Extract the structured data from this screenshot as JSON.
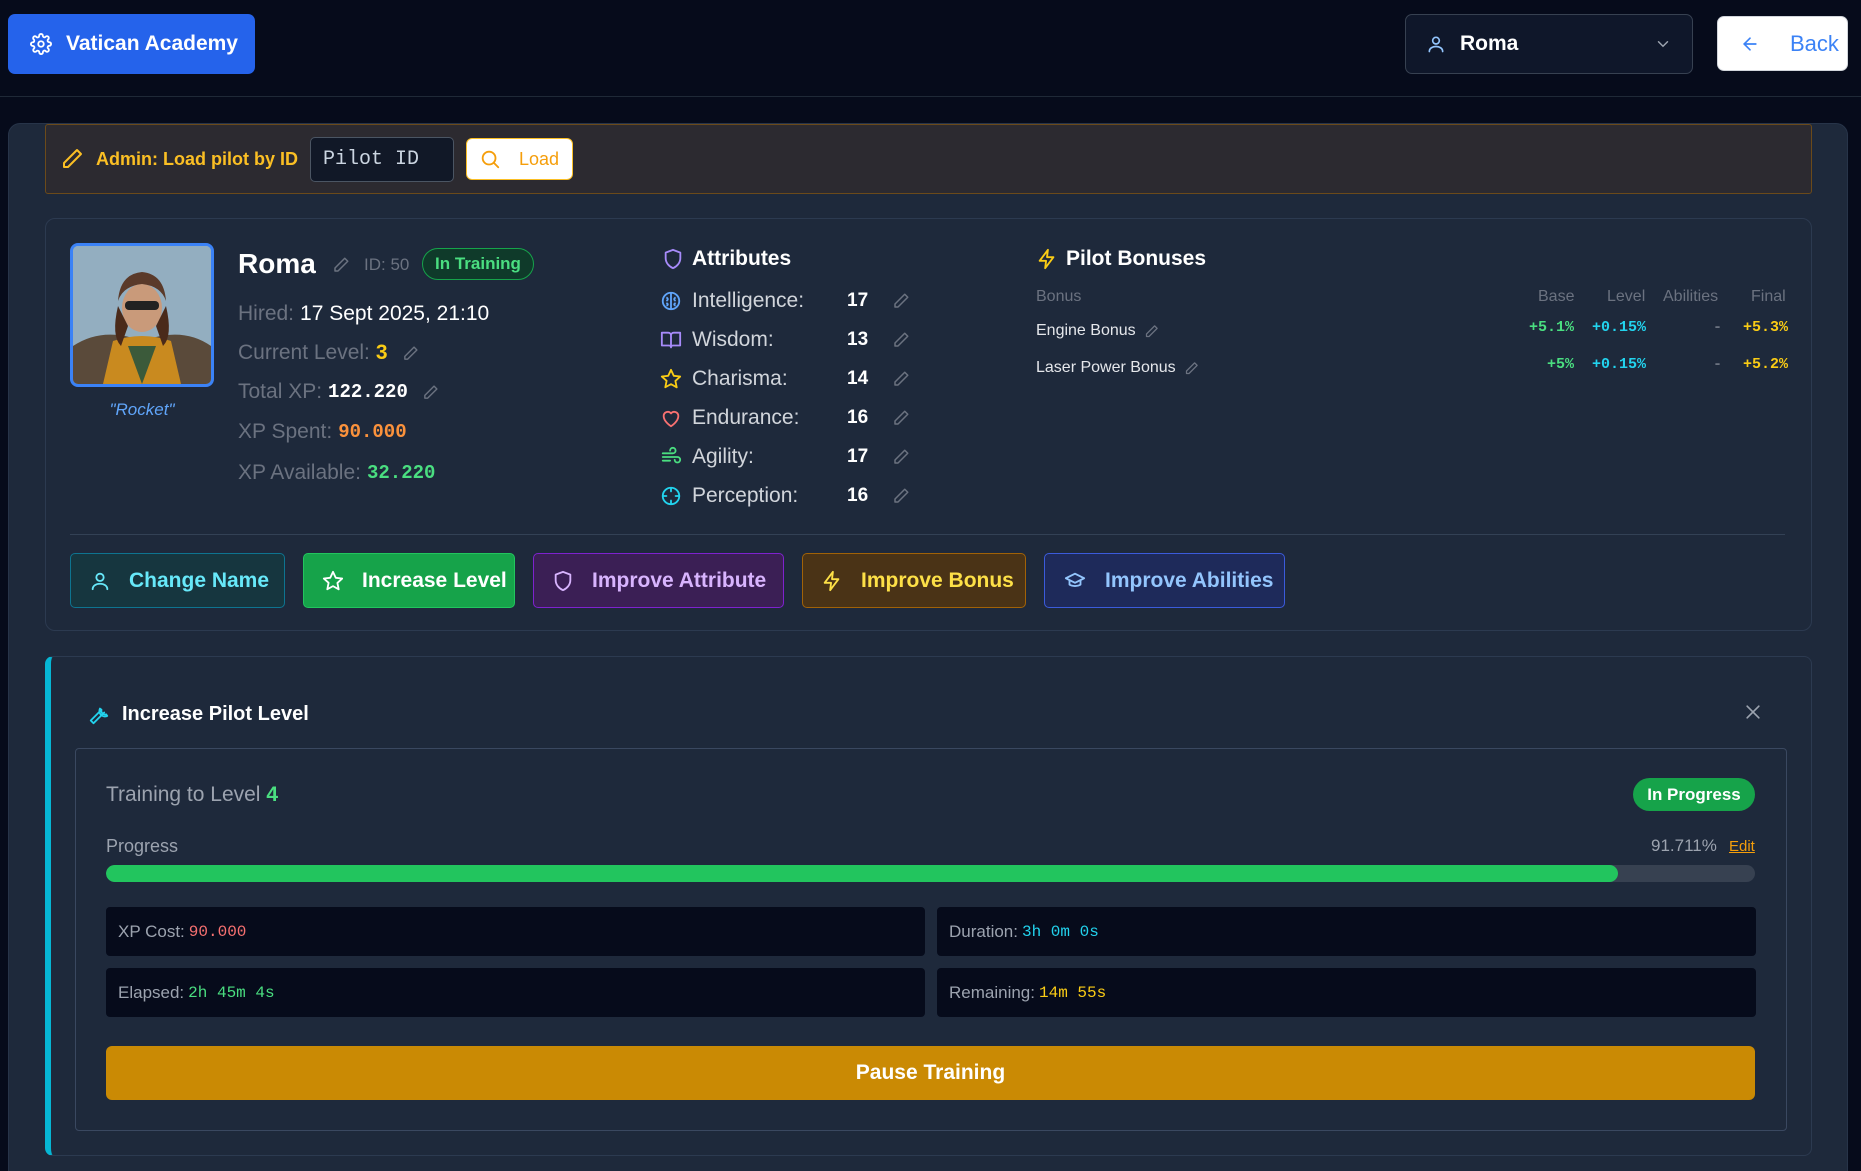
{
  "header": {
    "brand": "Vatican Academy",
    "user_select": "Roma",
    "back_label": "Back"
  },
  "admin": {
    "label": "Admin: Load pilot by ID",
    "pilot_id_placeholder": "Pilot ID",
    "load_label": "Load"
  },
  "pilot": {
    "name": "Roma",
    "id_label": "ID: 50",
    "status": "In Training",
    "callsign": "\"Rocket\"",
    "hired_label": "Hired:",
    "hired_value": "17 Sept 2025, 21:10",
    "level_label": "Current Level:",
    "level_value": "3",
    "xp_label": "Total XP:",
    "xp_value": "122.220",
    "xp_spent_label": "XP Spent:",
    "xp_spent_value": "90.000",
    "xp_avail_label": "XP Available:",
    "xp_avail_value": "32.220"
  },
  "attributes": {
    "title": "Attributes",
    "items": [
      {
        "label": "Intelligence:",
        "value": "17",
        "icon": "brain-icon"
      },
      {
        "label": "Wisdom:",
        "value": "13",
        "icon": "book-icon"
      },
      {
        "label": "Charisma:",
        "value": "14",
        "icon": "star-icon"
      },
      {
        "label": "Endurance:",
        "value": "16",
        "icon": "heart-icon"
      },
      {
        "label": "Agility:",
        "value": "17",
        "icon": "wind-icon"
      },
      {
        "label": "Perception:",
        "value": "16",
        "icon": "crosshair-icon"
      }
    ]
  },
  "bonuses": {
    "title": "Pilot Bonuses",
    "columns": [
      "Bonus",
      "Base",
      "Level",
      "Abilities",
      "Final"
    ],
    "rows": [
      {
        "name": "Engine Bonus",
        "base": "+5.1%",
        "level": "+0.15%",
        "abilities": "-",
        "final": "+5.3%"
      },
      {
        "name": "Laser Power Bonus",
        "base": "+5%",
        "level": "+0.15%",
        "abilities": "-",
        "final": "+5.2%"
      }
    ]
  },
  "actions": {
    "change_name": "Change Name",
    "increase_level": "Increase Level",
    "improve_attribute": "Improve Attribute",
    "improve_bonus": "Improve Bonus",
    "improve_abilities": "Improve Abilities"
  },
  "level_panel": {
    "title": "Increase Pilot Level",
    "training_to": "Training to Level",
    "target_level": "4",
    "status": "In Progress",
    "progress_label": "Progress",
    "progress_pct_text": "91.711%",
    "progress_fraction": 0.91711,
    "edit_label": "Edit",
    "xp_cost_label": "XP Cost:",
    "xp_cost_value": "90.000",
    "duration_label": "Duration:",
    "duration_value": "3h 0m 0s",
    "elapsed_label": "Elapsed:",
    "elapsed_value": "2h 45m 4s",
    "remaining_label": "Remaining:",
    "remaining_value": "14m 55s",
    "pause_label": "Pause Training"
  },
  "colors": {
    "accent_blue": "#2563eb",
    "success_green": "#22c55e",
    "warning_amber": "#ca8a04",
    "cyan_accent": "#06b6d4"
  }
}
